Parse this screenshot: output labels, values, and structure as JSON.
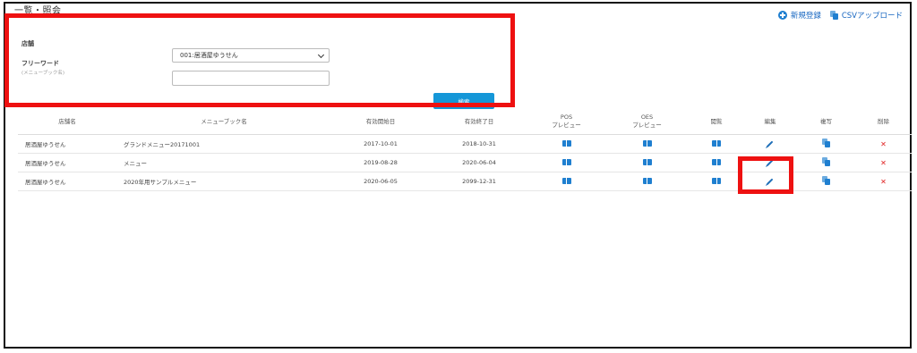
{
  "page": {
    "title": "一覧・照会"
  },
  "top_actions": {
    "new_label": "新規登録",
    "csv_label": "CSVアップロード"
  },
  "search": {
    "store_label": "店舗",
    "store_value": "001:居酒屋ゆうせん",
    "freeword_label": "フリーワード",
    "freeword_sub": "(メニューブック名)",
    "freeword_value": "",
    "search_button": "検索"
  },
  "table": {
    "headers": {
      "store": "店舗名",
      "menubook": "メニューブック名",
      "start": "有効開始日",
      "end": "有効終了日",
      "pos_1": "POS",
      "pos_2": "プレビュー",
      "oes_1": "OES",
      "oes_2": "プレビュー",
      "browse": "閲覧",
      "edit": "編集",
      "copy": "複写",
      "delete": "削除"
    },
    "rows": [
      {
        "store": "居酒屋ゆうせん",
        "menubook": "グランドメニュー20171001",
        "start": "2017-10-01",
        "end": "2018-10-31"
      },
      {
        "store": "居酒屋ゆうせん",
        "menubook": "メニュー",
        "start": "2019-08-28",
        "end": "2020-06-04"
      },
      {
        "store": "居酒屋ゆうせん",
        "menubook": "2020年用サンプルメニュー",
        "start": "2020-06-05",
        "end": "2099-12-31"
      }
    ],
    "delete_symbol": "✕"
  },
  "icons": [
    "plus-circle-icon",
    "copy-icon",
    "chevron-down-icon",
    "book-icon",
    "pencil-icon",
    "close-icon"
  ],
  "colors": {
    "accent": "#1597d8",
    "icon_blue": "#1f7fd0",
    "delete_red": "#e02020",
    "highlight": "#ee1111"
  }
}
